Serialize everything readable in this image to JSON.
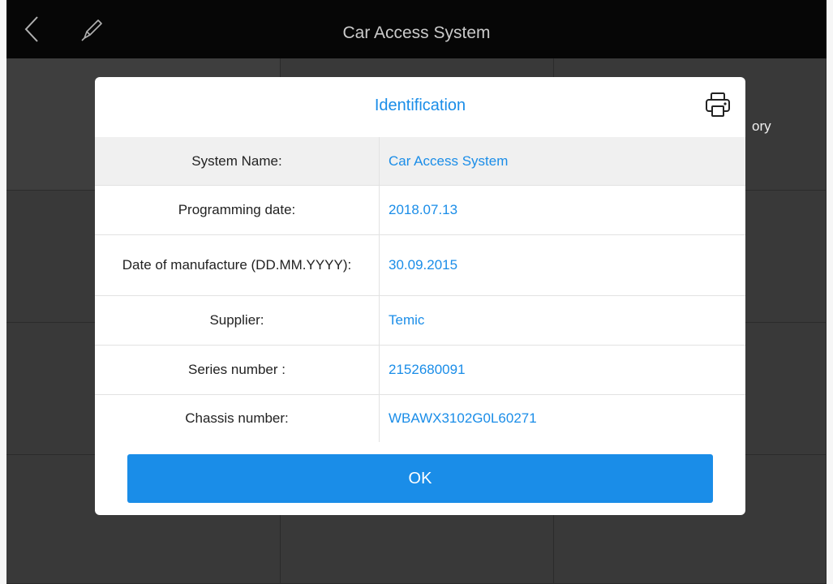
{
  "app": {
    "title": "Car Access System"
  },
  "background": {
    "partial_tile_text": "ory"
  },
  "dialog": {
    "title": "Identification",
    "rows": [
      {
        "label": "System Name:",
        "value": "Car Access System"
      },
      {
        "label": "Programming date:",
        "value": "2018.07.13"
      },
      {
        "label": "Date of manufacture (DD.MM.YYYY):",
        "value": "30.09.2015"
      },
      {
        "label": "Supplier:",
        "value": "Temic"
      },
      {
        "label": "Series number :",
        "value": "2152680091"
      },
      {
        "label": "Chassis number:",
        "value": "WBAWX3102G0L60271"
      }
    ],
    "ok_label": "OK"
  },
  "icons": {
    "back": "chevron-left-icon",
    "edit": "pencil-icon",
    "print": "printer-icon"
  },
  "colors": {
    "accent": "#1a8de8",
    "topbar": "#070707",
    "background": "#3a3a3a"
  }
}
